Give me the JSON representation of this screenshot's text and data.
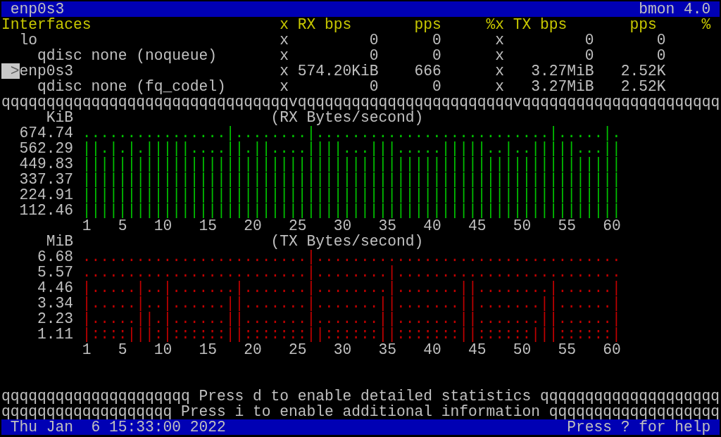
{
  "title_bar": {
    "interface": "enp0s3",
    "app": "bmon 4.0"
  },
  "header": {
    "title": "Interfaces",
    "columns": [
      "x",
      "RX bps",
      "pps",
      "%x",
      "TX bps",
      "pps",
      "%"
    ]
  },
  "selection_marker": ">",
  "interfaces": [
    {
      "name": "lo",
      "selected": false,
      "sep_rx": "x",
      "rx_bps": "0",
      "rx_pps": "0",
      "sep_tx": "x",
      "tx_bps": "0",
      "tx_pps": "0",
      "children": [
        {
          "name": "qdisc none (noqueue)",
          "selected": false,
          "sep_rx": "x",
          "rx_bps": "0",
          "rx_pps": "0",
          "sep_tx": "x",
          "tx_bps": "0",
          "tx_pps": "0"
        }
      ]
    },
    {
      "name": "enp0s3",
      "selected": true,
      "sep_rx": "x",
      "rx_bps": "574.20KiB",
      "rx_pps": "666",
      "sep_tx": "x",
      "tx_bps": "3.27MiB",
      "tx_pps": "2.52K",
      "children": [
        {
          "name": "qdisc none (fq_codel)",
          "selected": false,
          "sep_rx": "x",
          "rx_bps": "0",
          "rx_pps": "0",
          "sep_tx": "x",
          "tx_bps": "3.27MiB",
          "tx_pps": "2.52K"
        }
      ]
    }
  ],
  "separator": "qqqqqqqqqqqqqqqqqqqqqqqqqqqqqqqqvqqqqqqqqqqqqqqqqqqqqqqqqvqqqqqqqqqqqqqqqqqqqqqq",
  "graphs": [
    {
      "unit": "KiB",
      "title": "(RX Bytes/second)",
      "color": "#00c000",
      "yticks": [
        "674.74",
        "562.29",
        "449.83",
        "337.37",
        "224.91",
        "112.46"
      ],
      "rows": [
        "................|........|..........................|.....|.",
        "||.|.|.|||||....||.||....||||...|||.....|||||..|..|||||...||",
        "||||||||||||||||||||||||||||||||||||||||||||||||||||||||||||",
        "||||||||||||||||||||||||||||||||||||||||||||||||||||||||||||",
        "||||||||||||||||||||||||||||||||||||||||||||||||||||||||||||",
        "||||||||||||||||||||||||||||||||||||||||||||||||||||||||||||"
      ],
      "xticks": [
        "1",
        "5",
        "10",
        "15",
        "20",
        "25",
        "30",
        "35",
        "40",
        "45",
        "50",
        "55",
        "60"
      ]
    },
    {
      "unit": "MiB",
      "title": "(TX Bytes/second)",
      "color": "#c00000",
      "yticks": [
        "6.68",
        "5.57",
        "4.46",
        "3.34",
        "2.23",
        "1.11"
      ],
      "rows": [
        ".........................|..................................",
        ".........................|........|.........................",
        "|.....|..|.......|.......|........|.......||........|......|",
        "|.....|..|......||.......|.......||.......||.......||......|",
        "|.....||.|......||.......|.......||.......||.......||......|",
        "|::::|||:|::::::||:::::::||::::::||:::::::||::::::|||::::::|"
      ],
      "xticks": [
        "1",
        "5",
        "10",
        "15",
        "20",
        "25",
        "30",
        "35",
        "40",
        "45",
        "50",
        "55",
        "60"
      ]
    }
  ],
  "hints": [
    {
      "fill_left": "qqqqqqqqqqqqqqqqqqqqq",
      "text": "Press d to enable detailed statistics",
      "fill_right": "qqqqqqqqqqqqqqqqqqqq"
    },
    {
      "fill_left": "qqqqqqqqqqqqqqqqqqq",
      "text": "Press i to enable additional information",
      "fill_right": "qqqqqqqqqqqqqqqqqqq"
    }
  ],
  "status_bar": {
    "datetime": "Thu Jan  6 15:33:00 2022",
    "help": "Press ? for help"
  }
}
